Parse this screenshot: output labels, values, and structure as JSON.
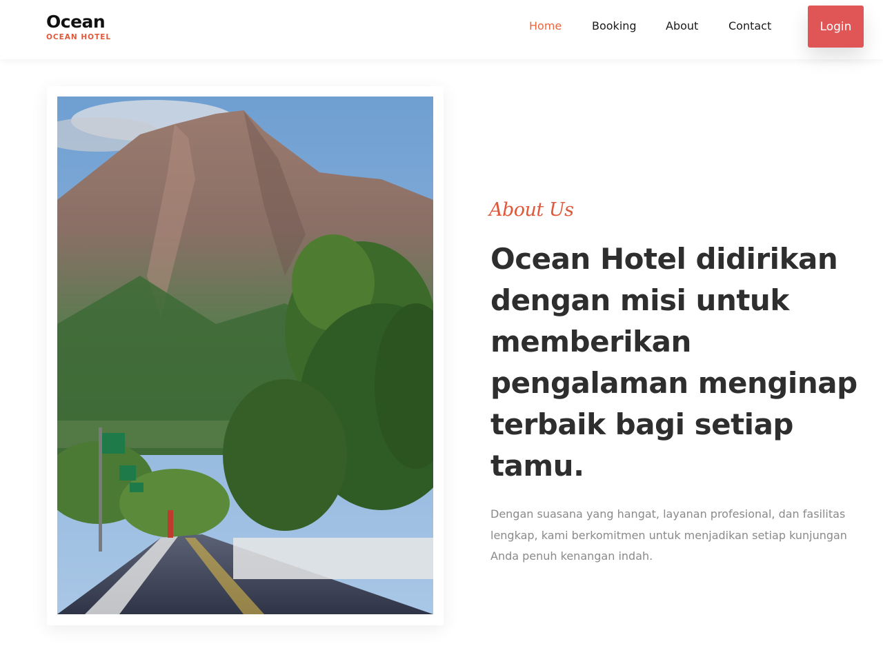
{
  "brand": {
    "name": "Ocean",
    "subtitle": "OCEAN HOTEL"
  },
  "nav": {
    "items": [
      {
        "label": "Home",
        "active": true
      },
      {
        "label": "Booking",
        "active": false
      },
      {
        "label": "About",
        "active": false
      },
      {
        "label": "Contact",
        "active": false
      }
    ],
    "login_label": "Login"
  },
  "about": {
    "eyebrow": "About Us",
    "title": "Ocean Hotel didirikan dengan misi untuk memberikan pengalaman menginap terbaik bagi setiap tamu.",
    "description": "Dengan suasana yang hangat, layanan profesional, dan fasilitas lengkap, kami berkomitmen untuk menjadikan setiap kunjungan Anda penuh kenangan indah."
  },
  "colors": {
    "accent": "#e9673f",
    "login_button": "#e05656",
    "heading": "#2e2e2e",
    "body_text": "#8a8a8a"
  }
}
